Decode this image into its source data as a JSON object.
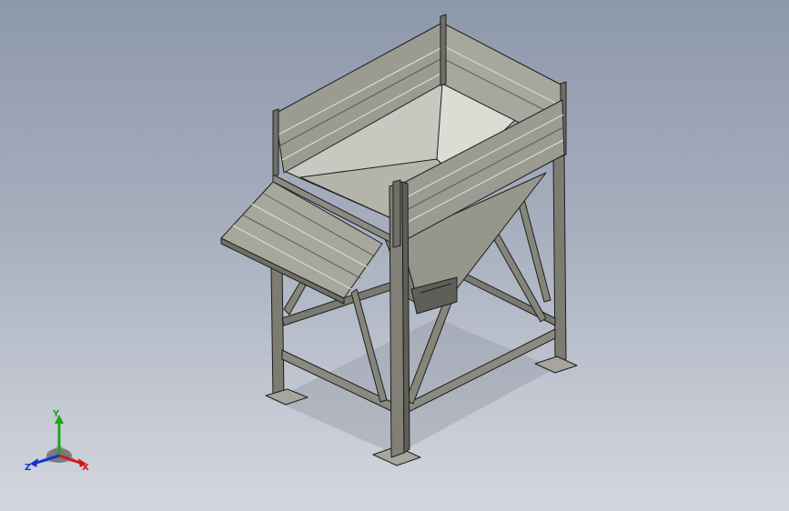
{
  "viewport": {
    "background_top": "#8d98ab",
    "background_bottom": "#d3d6dd"
  },
  "model": {
    "frame_color": "#7c7c73",
    "panel_color": "#9c9b92",
    "panel_light": "#c8c8c0",
    "edge_color": "#1e1e1e"
  },
  "triad": {
    "x_label": "X",
    "y_label": "Y",
    "z_label": "Z",
    "x_color": "#d11a1a",
    "y_color": "#1aa81a",
    "z_color": "#1a2fd1"
  }
}
